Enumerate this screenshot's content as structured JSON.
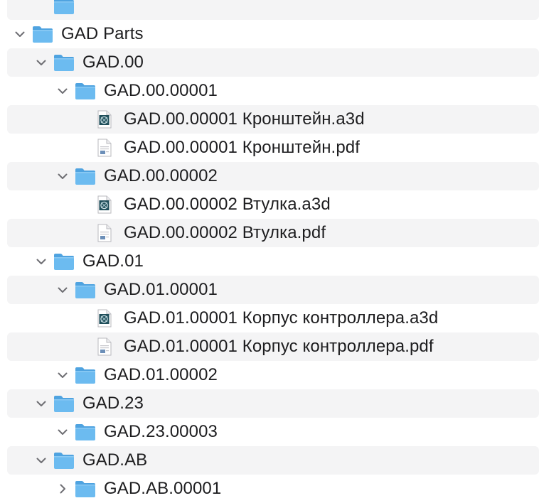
{
  "tree": {
    "rows": [
      {
        "label": "",
        "kind": "folder",
        "depth": 1,
        "expanded": false,
        "chevron": "none",
        "icon": "folder-icon"
      },
      {
        "label": "GAD Parts",
        "kind": "folder",
        "depth": 0,
        "expanded": true,
        "chevron": "chevron-down-icon",
        "icon": "folder-icon"
      },
      {
        "label": "GAD.00",
        "kind": "folder",
        "depth": 1,
        "expanded": true,
        "chevron": "chevron-down-icon",
        "icon": "folder-icon"
      },
      {
        "label": "GAD.00.00001",
        "kind": "folder",
        "depth": 2,
        "expanded": true,
        "chevron": "chevron-down-icon",
        "icon": "folder-icon"
      },
      {
        "label": "GAD.00.00001 Кронштейн.a3d",
        "kind": "a3d",
        "depth": 3,
        "chevron": "none",
        "icon": "a3d-file-icon"
      },
      {
        "label": "GAD.00.00001 Кронштейн.pdf",
        "kind": "pdf",
        "depth": 3,
        "chevron": "none",
        "icon": "pdf-file-icon"
      },
      {
        "label": "GAD.00.00002",
        "kind": "folder",
        "depth": 2,
        "expanded": true,
        "chevron": "chevron-down-icon",
        "icon": "folder-icon"
      },
      {
        "label": "GAD.00.00002 Втулка.a3d",
        "kind": "a3d",
        "depth": 3,
        "chevron": "none",
        "icon": "a3d-file-icon"
      },
      {
        "label": "GAD.00.00002 Втулка.pdf",
        "kind": "pdf",
        "depth": 3,
        "chevron": "none",
        "icon": "pdf-file-icon"
      },
      {
        "label": "GAD.01",
        "kind": "folder",
        "depth": 1,
        "expanded": true,
        "chevron": "chevron-down-icon",
        "icon": "folder-icon"
      },
      {
        "label": "GAD.01.00001",
        "kind": "folder",
        "depth": 2,
        "expanded": true,
        "chevron": "chevron-down-icon",
        "icon": "folder-icon"
      },
      {
        "label": "GAD.01.00001 Корпус контроллера.a3d",
        "kind": "a3d",
        "depth": 3,
        "chevron": "none",
        "icon": "a3d-file-icon"
      },
      {
        "label": "GAD.01.00001 Корпус контроллера.pdf",
        "kind": "pdf",
        "depth": 3,
        "chevron": "none",
        "icon": "pdf-file-icon"
      },
      {
        "label": "GAD.01.00002",
        "kind": "folder",
        "depth": 2,
        "expanded": true,
        "chevron": "chevron-down-icon",
        "icon": "folder-icon"
      },
      {
        "label": "GAD.23",
        "kind": "folder",
        "depth": 1,
        "expanded": true,
        "chevron": "chevron-down-icon",
        "icon": "folder-icon"
      },
      {
        "label": "GAD.23.00003",
        "kind": "folder",
        "depth": 2,
        "expanded": true,
        "chevron": "chevron-down-icon",
        "icon": "folder-icon"
      },
      {
        "label": "GAD.AB",
        "kind": "folder",
        "depth": 1,
        "expanded": true,
        "chevron": "chevron-down-icon",
        "icon": "folder-icon"
      },
      {
        "label": "GAD.AB.00001",
        "kind": "folder",
        "depth": 2,
        "expanded": false,
        "chevron": "chevron-right-icon",
        "icon": "folder-icon"
      }
    ]
  },
  "colors": {
    "folder_body": "#6cbbf0",
    "folder_tab": "#4fa3e0",
    "stripe": "#f4f4f5",
    "text": "#1d1d1f",
    "chevron": "#6e6e73"
  }
}
